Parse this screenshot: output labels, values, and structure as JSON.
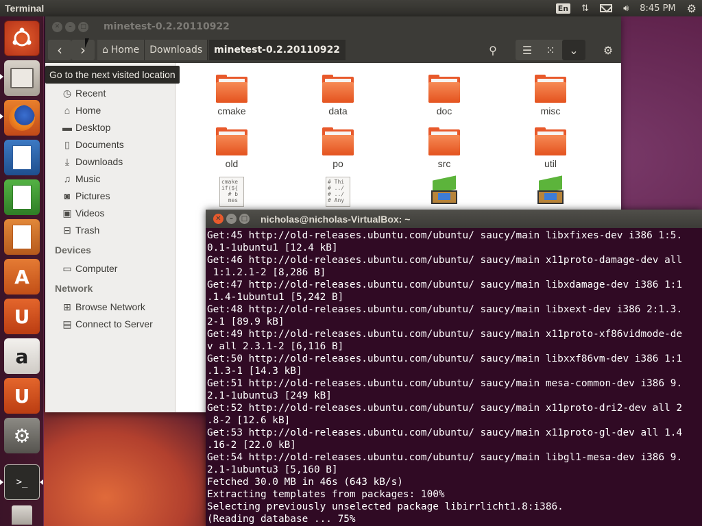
{
  "top_panel": {
    "app_title": "Terminal",
    "keyboard_indicator": "En",
    "clock": "8:45 PM"
  },
  "launcher": {
    "items": [
      "dash-home",
      "files",
      "firefox",
      "libreoffice-writer",
      "libreoffice-calc",
      "libreoffice-impress",
      "ubuntu-software-center",
      "ubuntu-one",
      "amazon",
      "ubuntu-one-music",
      "system-settings",
      "terminal",
      "trash"
    ]
  },
  "file_manager": {
    "title": "minetest-0.2.20110922",
    "tooltip": "Go to the next visited location",
    "breadcrumbs": [
      "Home",
      "Downloads",
      "minetest-0.2.20110922"
    ],
    "sidebar": {
      "places": [
        "Recent",
        "Home",
        "Desktop",
        "Documents",
        "Downloads",
        "Music",
        "Pictures",
        "Videos",
        "Trash"
      ],
      "devices_header": "Devices",
      "devices": [
        "Computer"
      ],
      "network_header": "Network",
      "network": [
        "Browse Network",
        "Connect to Server"
      ]
    },
    "files": [
      {
        "name": "cmake",
        "type": "folder"
      },
      {
        "name": "data",
        "type": "folder"
      },
      {
        "name": "doc",
        "type": "folder"
      },
      {
        "name": "misc",
        "type": "folder"
      },
      {
        "name": "old",
        "type": "folder"
      },
      {
        "name": "po",
        "type": "folder"
      },
      {
        "name": "src",
        "type": "folder"
      },
      {
        "name": "util",
        "type": "folder"
      }
    ],
    "file_preview_1": "cmake\nif(${\n  # b\n  mes",
    "file_preview_2": "# Thi\n# ../\n# ../\n# Any"
  },
  "terminal": {
    "title": "nicholas@nicholas-VirtualBox: ~",
    "lines": [
      "Get:45 http://old-releases.ubuntu.com/ubuntu/ saucy/main libxfixes-dev i386 1:5.",
      "0.1-1ubuntu1 [12.4 kB]",
      "Get:46 http://old-releases.ubuntu.com/ubuntu/ saucy/main x11proto-damage-dev all",
      " 1:1.2.1-2 [8,286 B]",
      "Get:47 http://old-releases.ubuntu.com/ubuntu/ saucy/main libxdamage-dev i386 1:1",
      ".1.4-1ubuntu1 [5,242 B]",
      "Get:48 http://old-releases.ubuntu.com/ubuntu/ saucy/main libxext-dev i386 2:1.3.",
      "2-1 [89.9 kB]",
      "Get:49 http://old-releases.ubuntu.com/ubuntu/ saucy/main x11proto-xf86vidmode-de",
      "v all 2.3.1-2 [6,116 B]",
      "Get:50 http://old-releases.ubuntu.com/ubuntu/ saucy/main libxxf86vm-dev i386 1:1",
      ".1.3-1 [14.3 kB]",
      "Get:51 http://old-releases.ubuntu.com/ubuntu/ saucy/main mesa-common-dev i386 9.",
      "2.1-1ubuntu3 [249 kB]",
      "Get:52 http://old-releases.ubuntu.com/ubuntu/ saucy/main x11proto-dri2-dev all 2",
      ".8-2 [12.6 kB]",
      "Get:53 http://old-releases.ubuntu.com/ubuntu/ saucy/main x11proto-gl-dev all 1.4",
      ".16-2 [22.0 kB]",
      "Get:54 http://old-releases.ubuntu.com/ubuntu/ saucy/main libgl1-mesa-dev i386 9.",
      "2.1-1ubuntu3 [5,160 B]",
      "Fetched 30.0 MB in 46s (643 kB/s)",
      "Extracting templates from packages: 100%",
      "Selecting previously unselected package libirrlicht1.8:i386.",
      "(Reading database ... 75%"
    ]
  },
  "colors": {
    "terminal_bg": "#300a24",
    "folder_orange": "#e8592b",
    "close_button": "#e95a2c",
    "panel_dark": "#3c3b37"
  }
}
